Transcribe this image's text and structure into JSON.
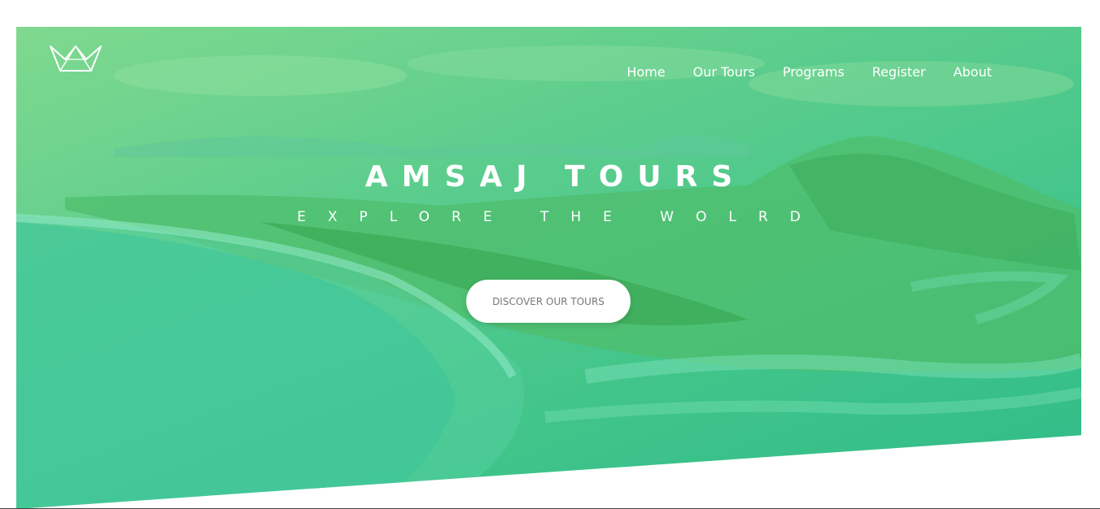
{
  "brand": {
    "logo_icon": "crown-logo-icon"
  },
  "nav": {
    "items": [
      {
        "label": "Home"
      },
      {
        "label": "Our Tours"
      },
      {
        "label": "Programs"
      },
      {
        "label": "Register"
      },
      {
        "label": "About"
      }
    ]
  },
  "hero": {
    "title": "AMSAJ TOURS",
    "subtitle": "EXPLORE THE WOLRD",
    "cta_label": "DISCOVER OUR TOURS",
    "overlay_colors": [
      "#7fd98e",
      "#3fc48a"
    ]
  }
}
